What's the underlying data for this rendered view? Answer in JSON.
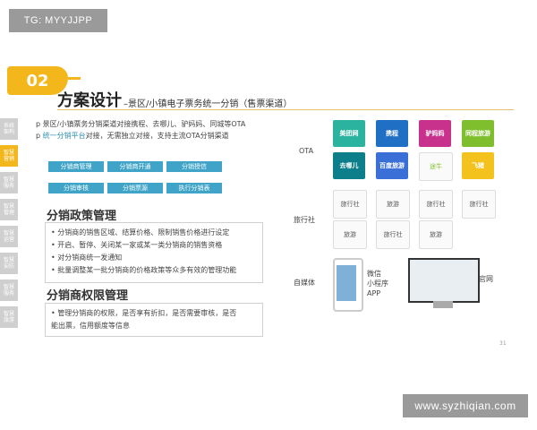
{
  "watermarks": {
    "top_left": "TG: MYYJJPP",
    "bottom_right": "www.syzhiqian.com"
  },
  "slide": {
    "badge": "02",
    "title": "方案设计",
    "subtitle": "–景区/小镇电子票务统一分销（售票渠道）",
    "sidenav": [
      {
        "label": "系统\n架构",
        "active": false
      },
      {
        "label": "智慧\n营销",
        "active": true
      },
      {
        "label": "智慧\n服务",
        "active": false
      },
      {
        "label": "智慧\n管理",
        "active": false
      },
      {
        "label": "智慧\n运营",
        "active": false
      },
      {
        "label": "智慧\n安防",
        "active": false
      },
      {
        "label": "智慧\n服务",
        "active": false
      },
      {
        "label": "智慧\n旅游",
        "active": false
      }
    ],
    "intro": {
      "line1": "p 景区/小镇票务分销渠道对接携程、去哪儿、驴妈妈、同城等OTA",
      "line2_prefix": "p ",
      "line2_highlight": "统一分销平台",
      "line2_rest": "对接，无需独立对接，支持主流OTA分销渠道"
    },
    "chips_row1": [
      "分销商管理",
      "分销商开通",
      "分销授信"
    ],
    "chips_row2": [
      "分销审核",
      "分销票源",
      "执行分销表"
    ],
    "policy": {
      "title": "分销政策管理",
      "items": [
        "• 分销商的销售区域、结算价格、限制销售价格进行设定",
        "• 开启、暂停、关闭某一家或某一类分销商的销售资格",
        "• 对分销商统一发通知",
        "• 批量调整某一批分销商的价格政策等众多有效的管理功能"
      ]
    },
    "permission": {
      "title": "分销商权限管理",
      "items": [
        "• 管理分销商的权限，是否享有折扣，是否需要审核，是否",
        "  能出票，信用额度等信息"
      ]
    },
    "channels": {
      "ota_label": "OTA",
      "agency_label": "旅行社",
      "media_label": "自媒体",
      "ota_logos": [
        {
          "text": "美团网",
          "color": "#2bb3a0"
        },
        {
          "text": "携程",
          "color": "#1f6fc4"
        },
        {
          "text": "驴妈妈",
          "color": "#c8318c"
        },
        {
          "text": "同程旅游",
          "color": "#7fbf2d"
        },
        {
          "text": "去哪儿",
          "color": "#0d7f8a"
        },
        {
          "text": "百度旅游",
          "color": "#3a6fd8"
        },
        {
          "text": "途牛",
          "color": "#ffffff"
        },
        {
          "text": "飞猪",
          "color": "#f4c21c"
        }
      ],
      "agency_logos": [
        "旅行社",
        "旅游",
        "旅行社",
        "旅行社",
        "旅游",
        "旅行社",
        "旅游"
      ],
      "media_items": [
        "微信",
        "小程序",
        "APP"
      ],
      "media_web": "官网"
    },
    "page_number": "31"
  }
}
